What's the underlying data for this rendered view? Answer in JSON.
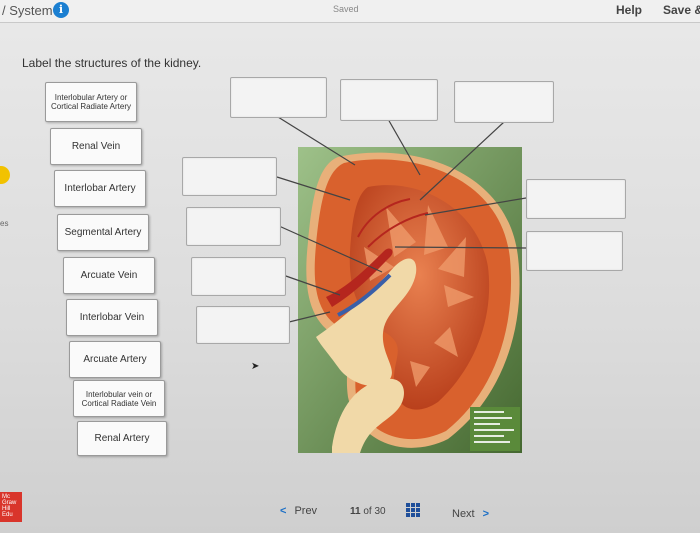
{
  "header": {
    "system_title": "/ System",
    "saved_status": "Saved",
    "help_label": "Help",
    "save_exit_label": "Save &"
  },
  "side": {
    "left_edge_text": "es"
  },
  "instruction": "Label the structures of the kidney.",
  "labels": [
    "Interlobular Artery or Cortical Radiate Artery",
    "Renal Vein",
    "Interlobar Artery",
    "Segmental Artery",
    "Arcuate Vein",
    "Interlobar Vein",
    "Arcuate Artery",
    "Interlobular vein or Cortical Radiate Vein",
    "Renal Artery"
  ],
  "navigation": {
    "prev_label": "Prev",
    "current_page": "11",
    "of_label": "of",
    "total_pages": "30",
    "next_label": "Next"
  },
  "icons": {
    "info": "info-icon",
    "prev": "chevron-left-icon",
    "next": "chevron-right-icon",
    "grid": "grid-icon"
  },
  "colors": {
    "accent": "#1b7fd1",
    "kidney_cortex": "#d9612d",
    "background_board": "#6aa04a",
    "logo_red": "#d9352b"
  }
}
